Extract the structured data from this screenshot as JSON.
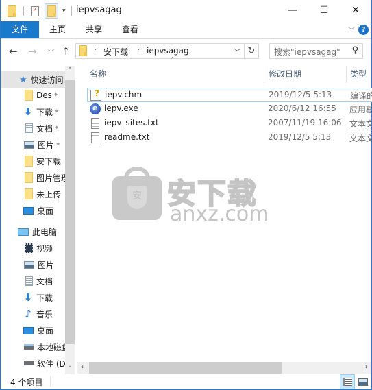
{
  "window": {
    "title": "iepvsagag",
    "controls": {
      "minimize": "—",
      "maximize": "☐",
      "close": "✕"
    }
  },
  "quick_access_toolbar": {
    "icons": [
      "folder-icon",
      "properties-icon",
      "new-folder-icon",
      "customize-dropdown-icon"
    ],
    "dropdown_glyph": "▾"
  },
  "ribbon": {
    "tabs": [
      {
        "label": "文件",
        "active": true
      },
      {
        "label": "主页"
      },
      {
        "label": "共享"
      },
      {
        "label": "查看"
      }
    ],
    "expand_glyph": "﹀",
    "help_glyph": "?"
  },
  "address_bar": {
    "back_glyph": "←",
    "forward_glyph": "→",
    "recent_glyph": "﹀",
    "up_glyph": "↑",
    "breadcrumbs": [
      "安下载",
      "iepvsagag"
    ],
    "crumb_separator": "›",
    "dropdown_glyph": "﹀",
    "refresh_glyph": "↻"
  },
  "search": {
    "placeholder": "搜索\"iepvsagag\"",
    "icon_glyph": "⚲"
  },
  "nav_pane": {
    "quick_access": {
      "label": "快速访问",
      "items": [
        {
          "label": "Des",
          "icon": "folder",
          "pinned": true
        },
        {
          "label": "下载",
          "icon": "download",
          "pinned": true
        },
        {
          "label": "文档",
          "icon": "document",
          "pinned": true
        },
        {
          "label": "图片",
          "icon": "picture",
          "pinned": true
        },
        {
          "label": "安下载",
          "icon": "folder"
        },
        {
          "label": "图片管理",
          "icon": "folder"
        },
        {
          "label": "未上传",
          "icon": "folder"
        },
        {
          "label": "桌面",
          "icon": "desktop"
        }
      ]
    },
    "this_pc": {
      "label": "此电脑",
      "items": [
        {
          "label": "视频",
          "icon": "video"
        },
        {
          "label": "图片",
          "icon": "picture"
        },
        {
          "label": "文档",
          "icon": "document"
        },
        {
          "label": "下载",
          "icon": "download"
        },
        {
          "label": "音乐",
          "icon": "music"
        },
        {
          "label": "桌面",
          "icon": "desktop"
        },
        {
          "label": "本地磁盘",
          "icon": "drive"
        },
        {
          "label": "软件 (D",
          "icon": "drive"
        }
      ]
    },
    "pin_glyph": "📌",
    "scroll_up_glyph": "˄",
    "scroll_down_glyph": "˅"
  },
  "file_list": {
    "columns": {
      "name": "名称",
      "date": "修改日期",
      "type": "类型"
    },
    "sort_glyph": "˄",
    "rows": [
      {
        "name": "iepv.chm",
        "date": "2019/12/5 5:13",
        "type": "编译的 HTML 帮助文件",
        "icon": "chm",
        "selected": true
      },
      {
        "name": "iepv.exe",
        "date": "2020/6/12 16:55",
        "type": "应用程序",
        "icon": "exe"
      },
      {
        "name": "iepv_sites.txt",
        "date": "2007/11/19 16:06",
        "type": "文本文档",
        "icon": "txt"
      },
      {
        "name": "readme.txt",
        "date": "2019/12/5 5:13",
        "type": "文本文档",
        "icon": "txt"
      }
    ]
  },
  "watermark": {
    "cn": "安下载",
    "en": "anxz.com",
    "shield_char": "安"
  },
  "hscroll": {
    "left_glyph": "‹",
    "right_glyph": "›"
  },
  "status_bar": {
    "item_count": "4 个项目",
    "view_mode": "details"
  },
  "colors": {
    "accent": "#1979ca",
    "selection_border": "#99d1ff",
    "header_text": "#4c607a"
  }
}
